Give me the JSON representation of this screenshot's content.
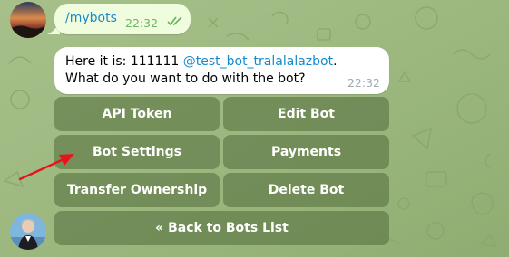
{
  "chat": {
    "outgoing": {
      "command": "/mybots",
      "time": "22:32"
    },
    "incoming": {
      "text_prefix": "Here it is: 111111 ",
      "mention": "@test_bot_tralalalazbot",
      "text_suffix": ".",
      "line2": "What do you want to do with the bot?",
      "time": "22:32"
    },
    "keyboard": {
      "api_token": "API Token",
      "edit_bot": "Edit Bot",
      "bot_settings": "Bot Settings",
      "payments": "Payments",
      "transfer_ownership": "Transfer Ownership",
      "delete_bot": "Delete Bot",
      "back_to_bots_list": "« Back to Bots List"
    }
  },
  "colors": {
    "background": "#9db980",
    "outgoing_bubble": "#effdde",
    "incoming_bubble": "#ffffff",
    "link": "#168acd",
    "keyboard_button": "#4e6838",
    "annotation_arrow": "#e8141c"
  },
  "icons": {
    "read_receipt": "double-check-icon",
    "annotation": "red-arrow-icon"
  }
}
